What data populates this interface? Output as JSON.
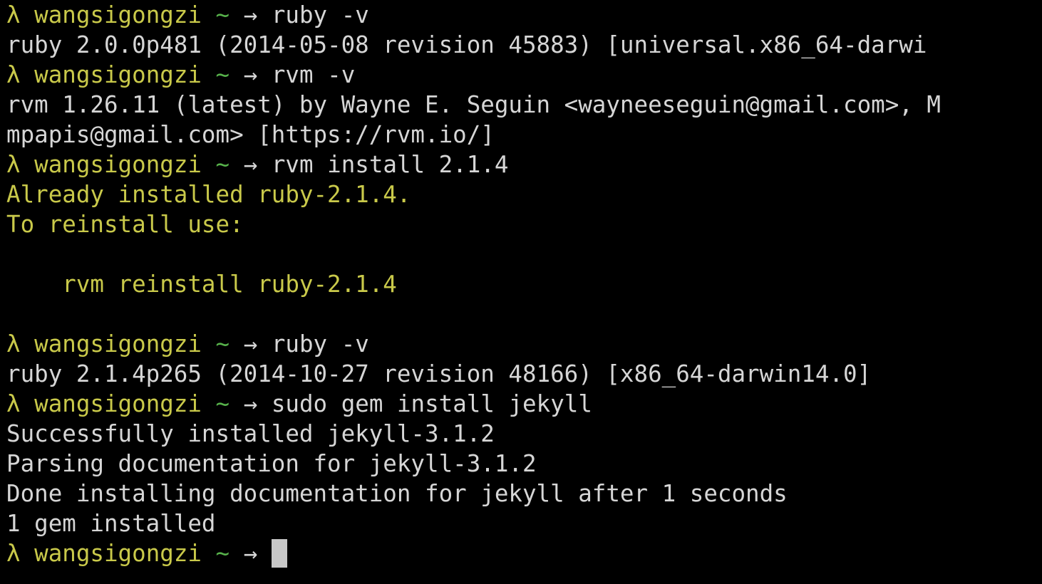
{
  "colors": {
    "background": "#000000",
    "prompt": "#c9c94a",
    "tilde": "#57b24b",
    "text": "#d6d6d6",
    "warning": "#c9c94a",
    "cursor": "#c8c8c8"
  },
  "prompt": {
    "symbol": "λ",
    "user": "wangsigongzi",
    "dir": "~",
    "arrow": "→"
  },
  "lines": [
    {
      "type": "prompt",
      "command": "ruby -v"
    },
    {
      "type": "output",
      "text": "ruby 2.0.0p481 (2014-05-08 revision 45883) [universal.x86_64-darwi"
    },
    {
      "type": "prompt",
      "command": "rvm -v"
    },
    {
      "type": "output",
      "text": "rvm 1.26.11 (latest) by Wayne E. Seguin <wayneeseguin@gmail.com>, M"
    },
    {
      "type": "output",
      "text": "mpapis@gmail.com> [https://rvm.io/]"
    },
    {
      "type": "prompt",
      "command": "rvm install 2.1.4"
    },
    {
      "type": "warn",
      "text": "Already installed ruby-2.1.4."
    },
    {
      "type": "warn",
      "text": "To reinstall use:"
    },
    {
      "type": "blank",
      "text": ""
    },
    {
      "type": "warn",
      "text": "    rvm reinstall ruby-2.1.4"
    },
    {
      "type": "blank",
      "text": ""
    },
    {
      "type": "prompt",
      "command": "ruby -v"
    },
    {
      "type": "output",
      "text": "ruby 2.1.4p265 (2014-10-27 revision 48166) [x86_64-darwin14.0]"
    },
    {
      "type": "prompt",
      "command": "sudo gem install jekyll"
    },
    {
      "type": "output",
      "text": "Successfully installed jekyll-3.1.2"
    },
    {
      "type": "output",
      "text": "Parsing documentation for jekyll-3.1.2"
    },
    {
      "type": "output",
      "text": "Done installing documentation for jekyll after 1 seconds"
    },
    {
      "type": "output",
      "text": "1 gem installed"
    },
    {
      "type": "prompt-active",
      "command": ""
    }
  ]
}
